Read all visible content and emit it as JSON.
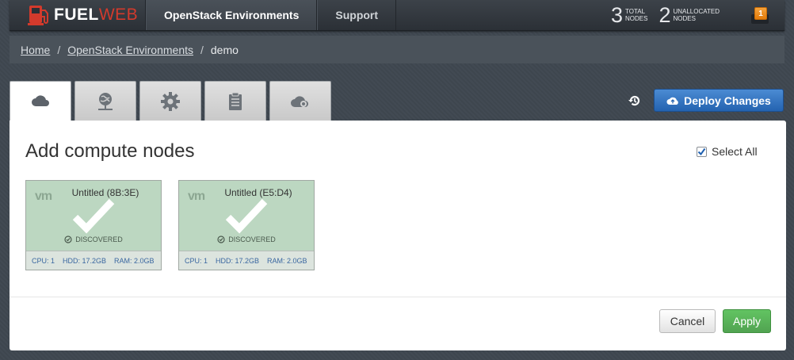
{
  "app": {
    "brand_primary": "FUEL",
    "brand_secondary": "WEB",
    "nav": [
      {
        "label": "OpenStack Environments",
        "active": true
      },
      {
        "label": "Support",
        "active": false
      }
    ]
  },
  "stats": {
    "total_nodes": {
      "count": "3",
      "label_line1": "TOTAL",
      "label_line2": "NODES"
    },
    "unallocated_nodes": {
      "count": "2",
      "label_line1": "UNALLOCATED",
      "label_line2": "NODES"
    },
    "notifications": "1"
  },
  "breadcrumb": [
    {
      "label": "Home",
      "link": true
    },
    {
      "label": "OpenStack Environments",
      "link": true
    },
    {
      "label": "demo",
      "link": false
    }
  ],
  "tabs": [
    {
      "icon": "cloud-icon",
      "active": true
    },
    {
      "icon": "network-icon",
      "active": false
    },
    {
      "icon": "gear-icon",
      "active": false
    },
    {
      "icon": "clipboard-icon",
      "active": false
    },
    {
      "icon": "cloud-health-icon",
      "active": false
    }
  ],
  "toolbar": {
    "history_icon": "history-icon",
    "deploy_label": "Deploy Changes"
  },
  "panel": {
    "title": "Add compute nodes",
    "select_all_label": "Select All",
    "select_all_checked": true
  },
  "nodes": [
    {
      "platform": "vm",
      "name": "Untitled (8B:3E)",
      "status": "DISCOVERED",
      "selected": true,
      "cpu": "CPU: 1",
      "hdd": "HDD: 17.2GB",
      "ram": "RAM: 2.0GB"
    },
    {
      "platform": "vm",
      "name": "Untitled (E5:D4)",
      "status": "DISCOVERED",
      "selected": true,
      "cpu": "CPU: 1",
      "hdd": "HDD: 17.2GB",
      "ram": "RAM: 2.0GB"
    }
  ],
  "actions": {
    "cancel_label": "Cancel",
    "apply_label": "Apply"
  },
  "colors": {
    "brand_red": "#d33a2c",
    "deploy_blue": "#2f6fbd",
    "apply_green": "#5bb75b",
    "node_selected": "#bcd7c1",
    "notification_orange": "#f0901f"
  }
}
